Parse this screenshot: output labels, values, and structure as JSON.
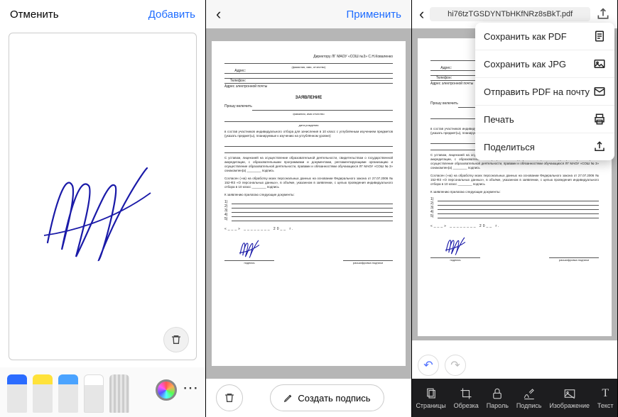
{
  "pane1": {
    "cancel": "Отменить",
    "add": "Добавить"
  },
  "pane2": {
    "apply": "Применить",
    "create_signature": "Создать подпись"
  },
  "pane3": {
    "filename": "hi76tzTGSDYNTbHKfNRz8sBkT.pdf",
    "menu": {
      "save_pdf": "Сохранить как PDF",
      "save_jpg": "Сохранить как JPG",
      "send_pdf": "Отправить PDF на почту",
      "print": "Печать",
      "share": "Поделиться"
    },
    "toolbar": {
      "pages": "Страницы",
      "crop": "Обрезка",
      "password": "Пароль",
      "sign": "Подпись",
      "image": "Изображение",
      "text": "Текст"
    }
  },
  "document": {
    "recipient": "Директору ЛГ МАОУ «СОШ №3» С.Н.Коваленко",
    "addr_label": "Адрес:",
    "phone_label": "Телефон:",
    "email_label": "Адрес электронной почты",
    "fio_label": "(фамилия, имя, отчество)",
    "title": "ЗАЯВЛЕНИЕ",
    "include": "Прошу включить",
    "fio_line": "фамилия, имя отчество",
    "dob": "дата рождения",
    "body1": "в состав участников индивидуального отбора для зачисления в 10 класс с углублённым изучением предметов (указать предмет(ы), планируемые к изучению на углублённом уровне):",
    "body2": "С уставом, лицензией на осуществление образовательной деятельности, свидетельством о государственной аккредитации, с образовательными программами и документами, регламентирующими организацию и осуществление образовательной деятельности, правами и обязанностями обучающихся ЛГ МАОУ «СОШ № 3» ознакомлен(а) ________ подпись",
    "body3": "Согласен (-на) на обработку моих персональных данных на основании Федерального закона от 27.07.2006 № 152-ФЗ «О персональных данных», в объёме, указанном в заявлении, с целью проведения индивидуального отбора в 10 класс ________ подпись",
    "attach": "К заявлению прилагаю следующие документы:",
    "date_fmt": "«___» ________ 20__ г.",
    "sig_label": "подпись",
    "sig_decrypt": "расшифровка подписи"
  }
}
